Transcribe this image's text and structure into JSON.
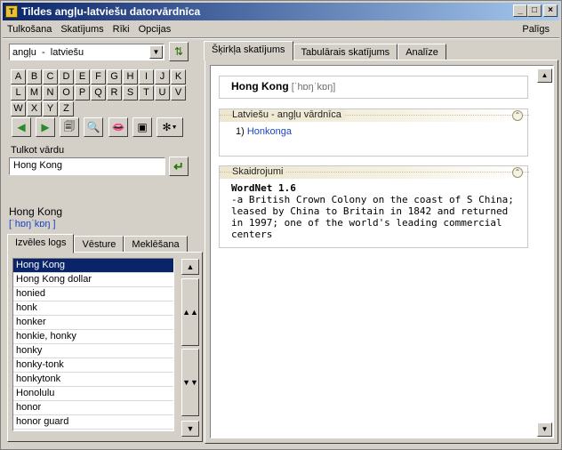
{
  "window": {
    "title": "Tildes angļu-latviešu datorvārdnīca",
    "app_icon": "app-logo-icon"
  },
  "menu": {
    "items": [
      "Tulkošana",
      "Skatījums",
      "Rīki",
      "Opcijas"
    ],
    "help": "Palīgs"
  },
  "left": {
    "lang_pair": "angļu  -  latviešu",
    "letters": [
      "A",
      "B",
      "C",
      "D",
      "E",
      "F",
      "G",
      "H",
      "I",
      "J",
      "K",
      "L",
      "M",
      "N",
      "O",
      "P",
      "Q",
      "R",
      "S",
      "T",
      "U",
      "V",
      "W",
      "X",
      "Y",
      "Z"
    ],
    "translate_label": "Tulkot vārdu",
    "translate_value": "Hong Kong",
    "headword": "Hong Kong",
    "pronunciation": "[ˈhɒŋˈkɒŋ ]",
    "tabs": [
      "Izvēles logs",
      "Vēsture",
      "Meklēšana"
    ],
    "list": [
      "Hong Kong",
      "Hong Kong dollar",
      "honied",
      "honk",
      "honker",
      "honkie, honky",
      "honky",
      "honky-tonk",
      "honkytonk",
      "Honolulu",
      "honor",
      "honor guard"
    ]
  },
  "right": {
    "tabs": [
      "Šķirkļa skatījums",
      "Tabulārais skatījums",
      "Analīze"
    ],
    "entry_word": "Hong Kong",
    "entry_pron": "[ˈhɒŋˈkɒŋ]",
    "dict_section": {
      "title": "Latviešu - angļu vārdnīca",
      "num": "1)",
      "translation": "Honkonga"
    },
    "expl_section": {
      "title": "Skaidrojumi",
      "source": "WordNet 1.6",
      "text": "-a British Crown Colony on the coast of S China; leased by China to Britain in 1842 and returned in 1997; one of the world's leading commercial centers"
    }
  },
  "colors": {
    "titlebar": "#0a246a",
    "link": "#1a44c8",
    "selection": "#0a246a"
  }
}
